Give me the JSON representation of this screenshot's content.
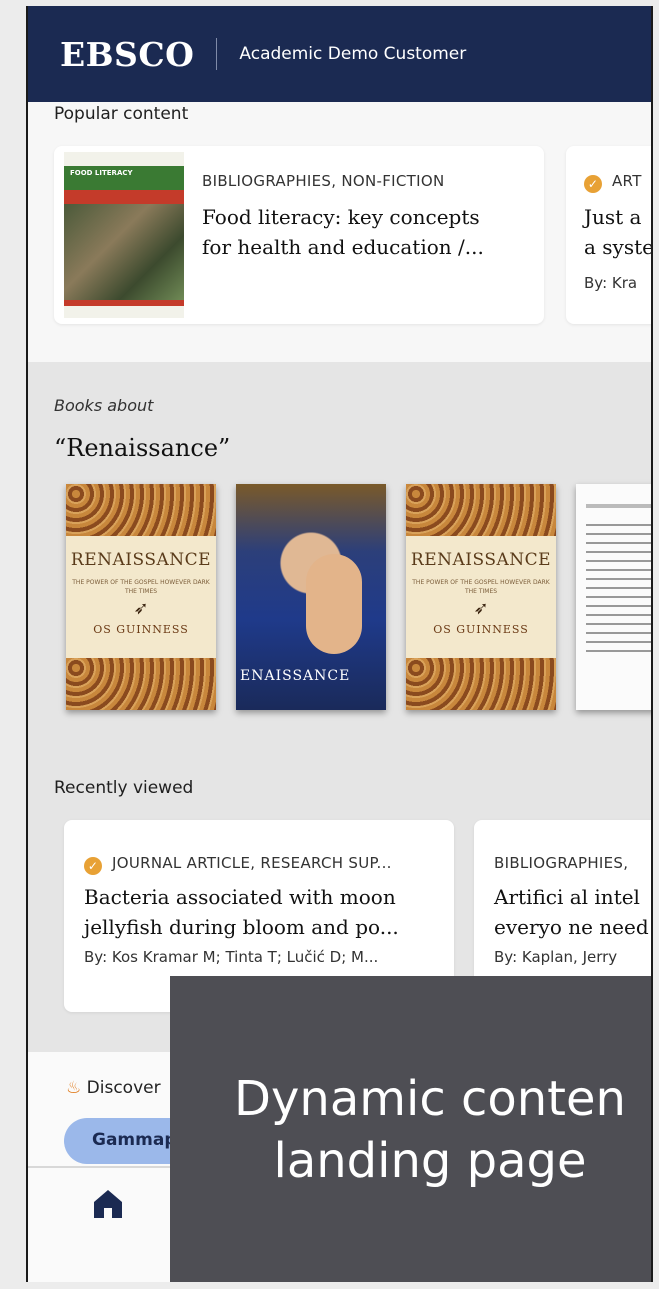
{
  "header": {
    "logo": "EBSCO",
    "customer": "Academic Demo Customer"
  },
  "popular": {
    "title": "Popular content",
    "cards": [
      {
        "kicker": "BIBLIOGRAPHIES,  NON-FICTION",
        "title_line1": "Food literacy: key concepts",
        "title_line2": "for health and education /...",
        "cover_label": "FOOD LITERACY"
      },
      {
        "kicker": "ART",
        "title_line1": "Just a",
        "title_line2": "a syste",
        "byline": "By: Kra"
      }
    ]
  },
  "books": {
    "kicker": "Books about",
    "title": "“Renaissance”",
    "items": [
      {
        "title": "RENAISSANCE",
        "sub": "THE POWER OF THE GOSPEL HOWEVER DARK THE TIMES",
        "author": "OS GUINNESS"
      },
      {
        "title": "ENAISSANCE"
      },
      {
        "title": "RENAISSANCE",
        "sub": "THE POWER OF THE GOSPEL HOWEVER DARK THE TIMES",
        "author": "OS GUINNESS"
      },
      {
        "title": ""
      }
    ]
  },
  "recent": {
    "title": "Recently viewed",
    "cards": [
      {
        "kicker": "JOURNAL ARTICLE,  RESEARCH SUP...",
        "title_line1": "Bacteria associated with moon",
        "title_line2": "jellyfish during bloom and po...",
        "byline": "By: Kos Kramar M; Tinta T; Lučić D; M..."
      },
      {
        "kicker": "BIBLIOGRAPHIES,",
        "title_line1": "Artifici al intel",
        "title_line2": "everyo ne need",
        "byline": "By: Kaplan, Jerry"
      }
    ]
  },
  "discover": {
    "label": "Discover",
    "pill": "Gammap"
  },
  "overlay": {
    "line1": "Dynamic conten",
    "line2": "landing page"
  },
  "colors": {
    "header_bg": "#1b2a52",
    "badge": "#e8a135",
    "pill": "#9bb8ea",
    "overlay": "#4e4e54"
  }
}
